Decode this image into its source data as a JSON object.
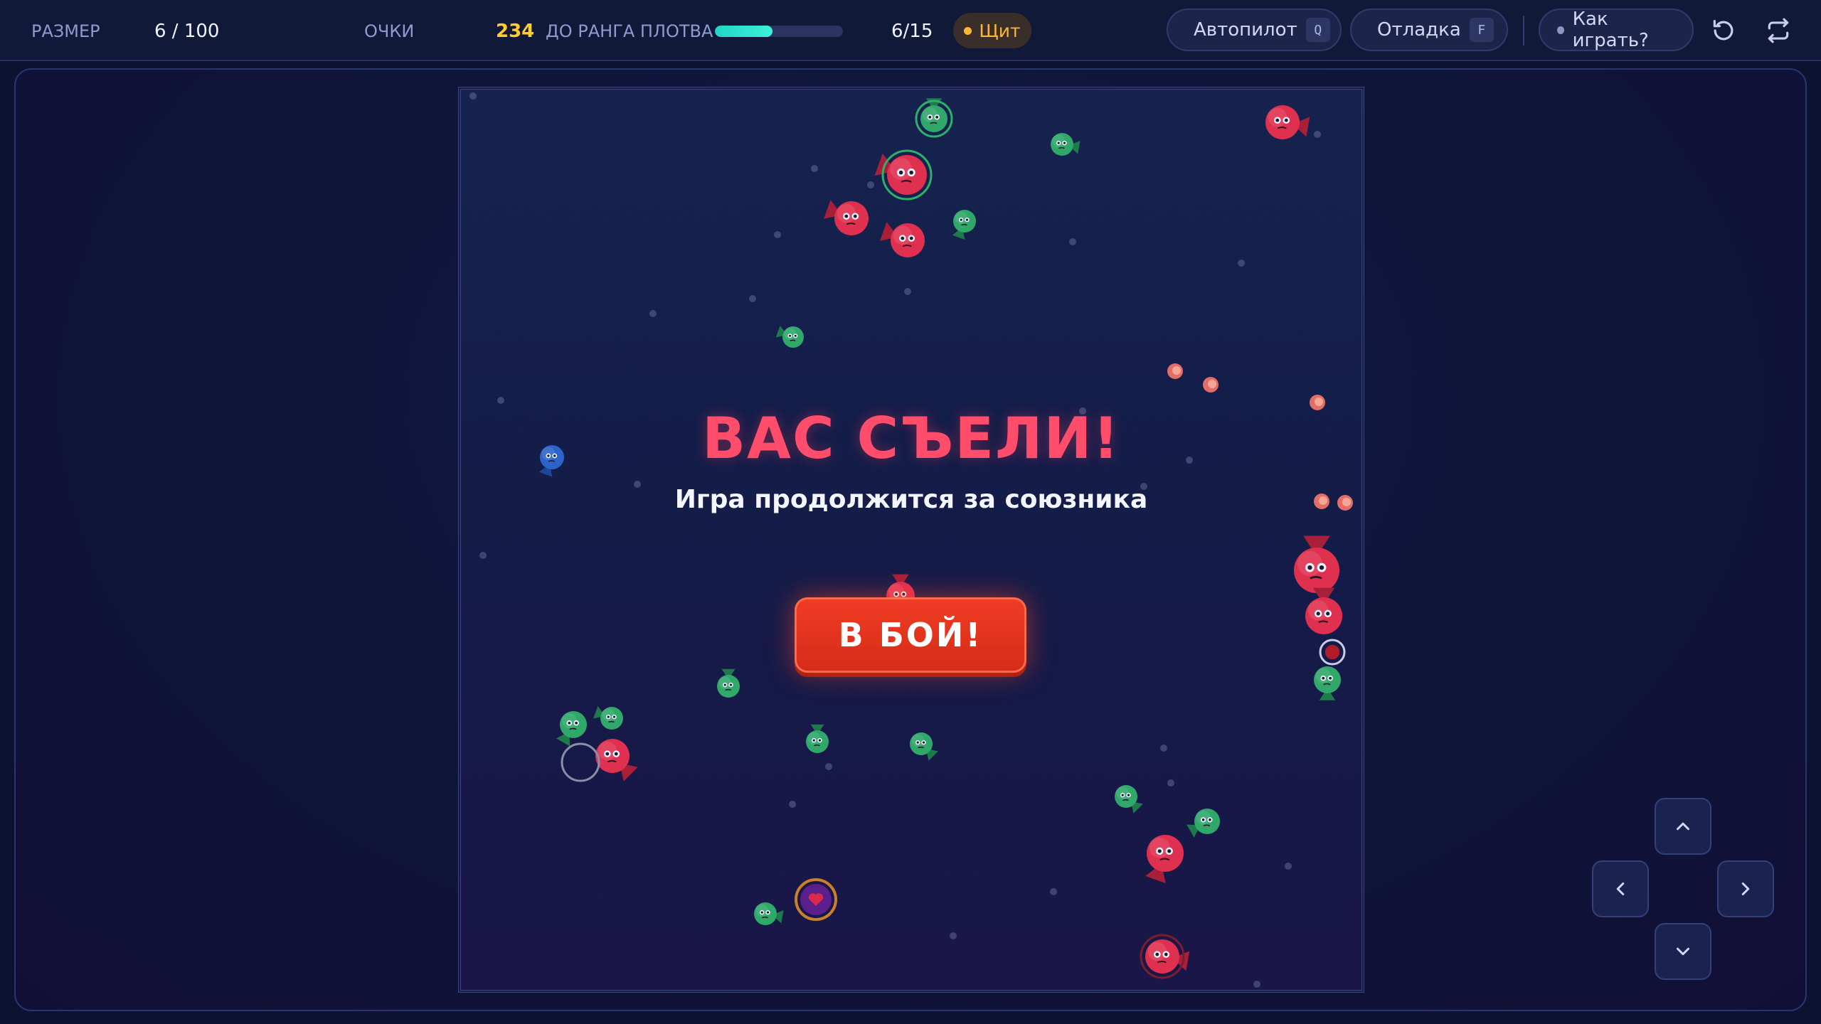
{
  "hud": {
    "size_label": "РАЗМЕР",
    "size_value": "6 / 100",
    "score_label": "ОЧКИ",
    "score_value": "234",
    "rank_label": "ДО РАНГА ПЛОТВА",
    "rank_progress_fraction": 0.45,
    "rank_value": "6/15",
    "shield_label": "Щит"
  },
  "controls": {
    "autopilot_label": "Автопилот",
    "autopilot_key": "Q",
    "debug_label": "Отладка",
    "debug_key": "F",
    "howto_label": "Как играть?",
    "restart_icon": "restart-icon",
    "swap_icon": "swap-icon"
  },
  "overlay": {
    "title": "ВАС СЪЕЛИ!",
    "subtitle": "Игра продолжится за союзника",
    "button_label": "В БОЙ!"
  },
  "dpad": {
    "up_icon": "chevron-up-icon",
    "down_icon": "chevron-down-icon",
    "left_icon": "chevron-left-icon",
    "right_icon": "chevron-right-icon"
  },
  "colors": {
    "enemy": "#e0304f",
    "ally": "#2fa86a",
    "player_ghost": "#2b63c9",
    "accent_score": "#ffcc2e",
    "accent_shield": "#ffb733",
    "title_red": "#ff4d6b",
    "button_red": "#e0321c"
  }
}
